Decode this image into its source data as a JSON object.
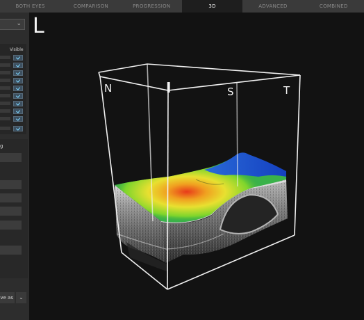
{
  "tabs": [
    "BOTH EYES",
    "COMPARISON",
    "PROGRESSION",
    "3D",
    "ADVANCED",
    "COMBINED"
  ],
  "active_tab": "3D",
  "left_panel": {
    "visible_header": "Visible",
    "section_label": "g",
    "save_as_label": "ve as"
  },
  "viewer": {
    "eye_label": "L",
    "orientation_labels": {
      "nasal": "N",
      "inferior": "I",
      "superior": "S",
      "temporal": "T"
    }
  },
  "icons": {
    "dropdown": "chevron-down-icon",
    "checkbox": "checkmark-icon"
  }
}
